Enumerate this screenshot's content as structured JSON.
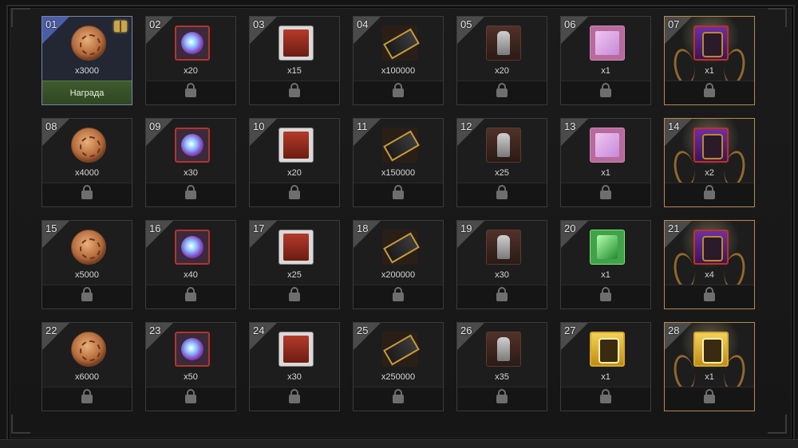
{
  "claim_label": "Награда",
  "rows": [
    [
      {
        "num": "01",
        "qty": "x3000",
        "icon": "cookie-icon",
        "type": "cookie",
        "state": "claimable"
      },
      {
        "num": "02",
        "qty": "x20",
        "icon": "orb-icon",
        "type": "orb",
        "state": "locked"
      },
      {
        "num": "03",
        "qty": "x15",
        "icon": "card-icon",
        "type": "card",
        "state": "locked"
      },
      {
        "num": "04",
        "qty": "x100000",
        "icon": "ticket-icon",
        "type": "ticket",
        "state": "locked"
      },
      {
        "num": "05",
        "qty": "x20",
        "icon": "statue-icon",
        "type": "statue",
        "state": "locked"
      },
      {
        "num": "06",
        "qty": "x1",
        "icon": "pink-scroll-icon",
        "type": "scroll-pink",
        "state": "locked"
      },
      {
        "num": "07",
        "qty": "x1",
        "icon": "purple-card-icon",
        "type": "purple",
        "state": "locked",
        "gold": true
      }
    ],
    [
      {
        "num": "08",
        "qty": "x4000",
        "icon": "cookie-icon",
        "type": "cookie",
        "state": "locked"
      },
      {
        "num": "09",
        "qty": "x30",
        "icon": "orb-icon",
        "type": "orb",
        "state": "locked"
      },
      {
        "num": "10",
        "qty": "x20",
        "icon": "card-icon",
        "type": "card",
        "state": "locked"
      },
      {
        "num": "11",
        "qty": "x150000",
        "icon": "ticket-icon",
        "type": "ticket",
        "state": "locked"
      },
      {
        "num": "12",
        "qty": "x25",
        "icon": "statue-icon",
        "type": "statue",
        "state": "locked"
      },
      {
        "num": "13",
        "qty": "x1",
        "icon": "pink-scroll-icon",
        "type": "scroll-pink",
        "state": "locked"
      },
      {
        "num": "14",
        "qty": "x2",
        "icon": "purple-card-icon",
        "type": "purple",
        "state": "locked",
        "gold": true
      }
    ],
    [
      {
        "num": "15",
        "qty": "x5000",
        "icon": "cookie-icon",
        "type": "cookie",
        "state": "locked"
      },
      {
        "num": "16",
        "qty": "x40",
        "icon": "orb-icon",
        "type": "orb",
        "state": "locked"
      },
      {
        "num": "17",
        "qty": "x25",
        "icon": "card-icon",
        "type": "card",
        "state": "locked"
      },
      {
        "num": "18",
        "qty": "x200000",
        "icon": "ticket-icon",
        "type": "ticket",
        "state": "locked"
      },
      {
        "num": "19",
        "qty": "x30",
        "icon": "statue-icon",
        "type": "statue",
        "state": "locked"
      },
      {
        "num": "20",
        "qty": "x1",
        "icon": "green-scroll-icon",
        "type": "scroll-green",
        "state": "locked"
      },
      {
        "num": "21",
        "qty": "x4",
        "icon": "purple-card-icon",
        "type": "purple",
        "state": "locked",
        "gold": true
      }
    ],
    [
      {
        "num": "22",
        "qty": "x6000",
        "icon": "cookie-icon",
        "type": "cookie",
        "state": "locked"
      },
      {
        "num": "23",
        "qty": "x50",
        "icon": "orb-icon",
        "type": "orb",
        "state": "locked"
      },
      {
        "num": "24",
        "qty": "x30",
        "icon": "card-icon",
        "type": "card",
        "state": "locked"
      },
      {
        "num": "25",
        "qty": "x250000",
        "icon": "ticket-icon",
        "type": "ticket",
        "state": "locked"
      },
      {
        "num": "26",
        "qty": "x35",
        "icon": "statue-icon",
        "type": "statue",
        "state": "locked"
      },
      {
        "num": "27",
        "qty": "x1",
        "icon": "gold-card-icon",
        "type": "gold",
        "state": "locked"
      },
      {
        "num": "28",
        "qty": "x1",
        "icon": "gold-card-icon",
        "type": "gold",
        "state": "locked",
        "gold": true
      }
    ]
  ]
}
